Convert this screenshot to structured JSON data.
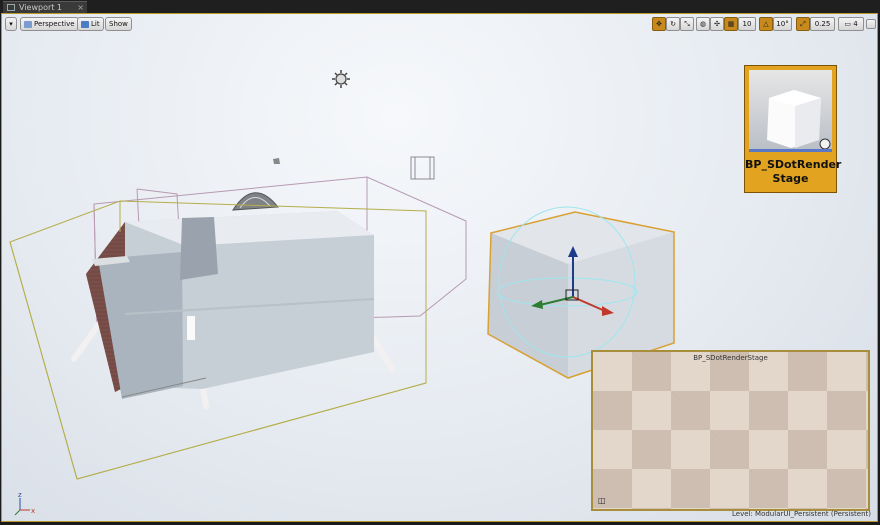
{
  "tab": {
    "title": "Viewport 1",
    "close": "×"
  },
  "toolbar": {
    "menu_glyph": "▾",
    "perspective": "Perspective",
    "lit": "Lit",
    "show": "Show"
  },
  "right_toolbar": {
    "grid_snap": "10",
    "rotation_snap": "10°",
    "scale_snap": "0.25",
    "camera_speed": "4"
  },
  "thumbnail": {
    "caption": "BP_SDotRender Stage"
  },
  "preview": {
    "title": "BP_SDotRenderStage",
    "speaker_icon": "speaker-icon"
  },
  "status": {
    "level": "Level:  ModularUI_Persistent (Persistent)"
  },
  "axis": {
    "z": "z",
    "x": "x"
  },
  "colors": {
    "accent": "#e2a420",
    "selection": "#d9a032",
    "gizmo_z": "#1e3a8a",
    "gizmo_x": "#c0392b",
    "gizmo_y": "#2e7d32"
  }
}
